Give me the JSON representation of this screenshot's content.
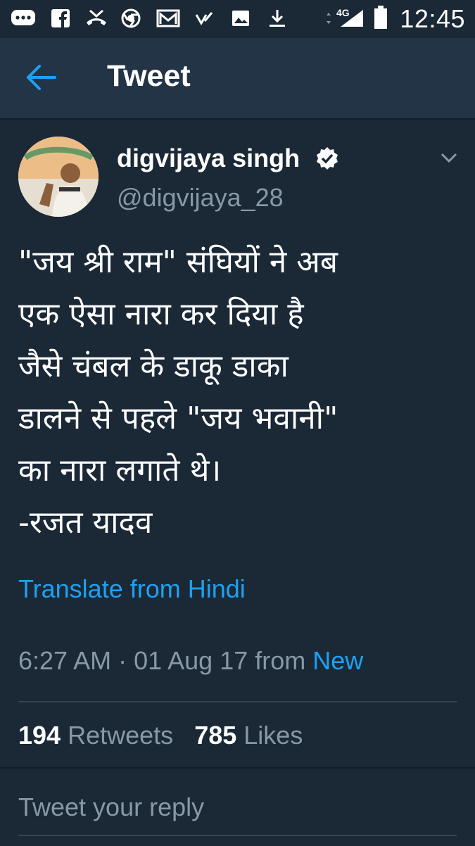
{
  "status_bar": {
    "network": "4G",
    "time": "12:45",
    "icons": [
      "chat-bubble-icon",
      "facebook-icon",
      "missed-call-icon",
      "chrome-icon",
      "gmail-icon",
      "checkmark-icon",
      "image-icon",
      "download-icon",
      "signal-icon",
      "battery-icon"
    ]
  },
  "header": {
    "title": "Tweet",
    "back_icon": "back-arrow-icon"
  },
  "tweet": {
    "author_name": "digvijaya singh",
    "verified": true,
    "handle": "@digvijaya_28",
    "text": "\"जय श्री राम\" संघियों ने अब\nएक ऐसा नारा कर दिया है\nजैसे चंबल के डाकू डाका\nडालने से पहले \"जय भवानी\"\nका नारा लगाते थे।\n-रजत यादव",
    "translate_label": "Translate from Hindi",
    "timestamp": "6:27 AM · 01 Aug 17 from ",
    "source": "New",
    "retweets_count": "194",
    "retweets_label": "Retweets",
    "likes_count": "785",
    "likes_label": "Likes"
  },
  "reply": {
    "placeholder": "Tweet your reply"
  },
  "colors": {
    "background": "#1b2836",
    "app_bar": "#243447",
    "accent": "#1da1f2",
    "muted_text": "#8899a6"
  }
}
